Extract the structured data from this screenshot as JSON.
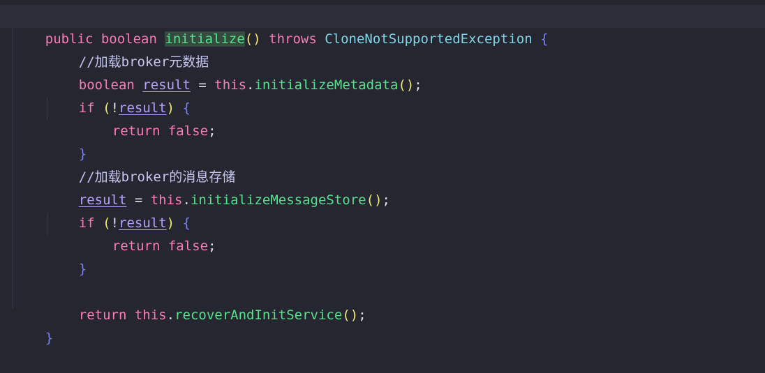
{
  "code": {
    "line1": {
      "kw_public": "public",
      "kw_boolean": "boolean",
      "fn_name": "initialize",
      "parens": "()",
      "kw_throws": "throws",
      "exception": "CloneNotSupportedException",
      "brace": "{"
    },
    "line2": {
      "comment": "//加载broker元数据"
    },
    "line3": {
      "kw_boolean": "boolean",
      "var": "result",
      "assign": " = ",
      "kw_this": "this",
      "dot": ".",
      "method": "initializeMetadata",
      "parens": "()",
      "semi": ";"
    },
    "line4": {
      "kw_if": "if",
      "paren_open": "(",
      "not": "!",
      "var": "result",
      "paren_close": ")",
      "brace": "{"
    },
    "line5": {
      "kw_return": "return",
      "kw_false": "false",
      "semi": ";"
    },
    "line6": {
      "brace": "}"
    },
    "line7": {
      "comment": "//加载broker的消息存储"
    },
    "line8": {
      "var": "result",
      "assign": " = ",
      "kw_this": "this",
      "dot": ".",
      "method": "initializeMessageStore",
      "parens": "()",
      "semi": ";"
    },
    "line9": {
      "kw_if": "if",
      "paren_open": "(",
      "not": "!",
      "var": "result",
      "paren_close": ")",
      "brace": "{"
    },
    "line10": {
      "kw_return": "return",
      "kw_false": "false",
      "semi": ";"
    },
    "line11": {
      "brace": "}"
    },
    "line13": {
      "kw_return": "return",
      "kw_this": "this",
      "dot": ".",
      "method": "recoverAndInitService",
      "parens": "()",
      "semi": ";"
    },
    "line14": {
      "brace": "}"
    }
  },
  "colors": {
    "background": "#262631",
    "keyword": "#f77eb4",
    "function": "#59e08c",
    "type": "#81d6e8",
    "brace": "#7b82f0",
    "paren": "#f0ea72",
    "variable": "#b5a2ff",
    "comment": "#c4c6f0"
  }
}
